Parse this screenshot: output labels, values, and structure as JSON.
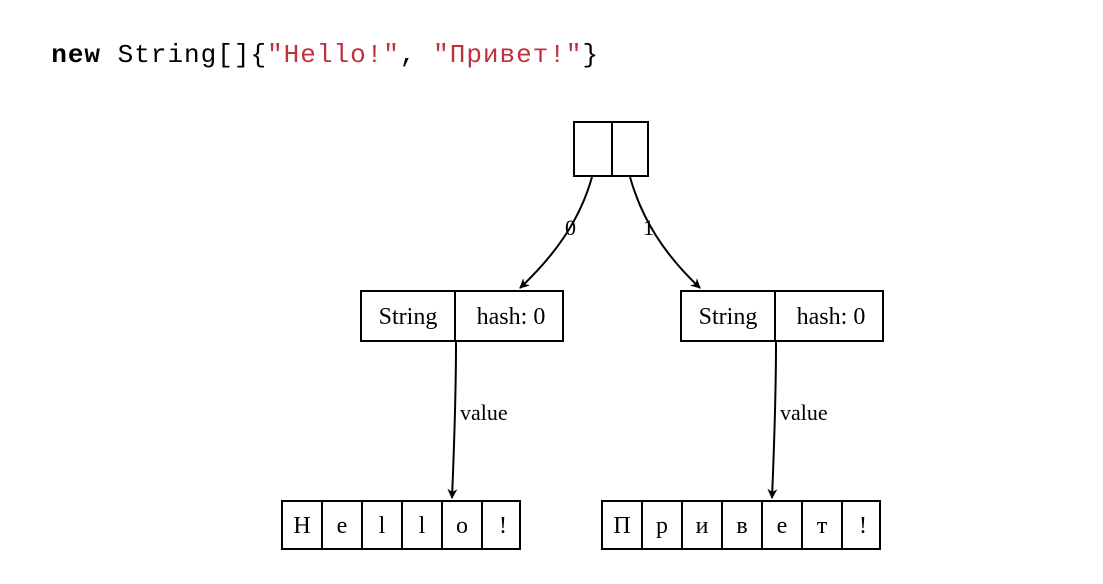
{
  "code": {
    "keyword": "new",
    "type": " String[]{",
    "str1": "\"Hello!\"",
    "comma": ", ",
    "str2": "\"Привет!\"",
    "close": "}"
  },
  "diagram": {
    "root_index_left": "0",
    "root_index_right": "1",
    "string_obj_left": {
      "type": "String",
      "hash": "hash: 0"
    },
    "string_obj_right": {
      "type": "String",
      "hash": "hash: 0"
    },
    "value_label_left": "value",
    "value_label_right": "value",
    "chars_left": [
      "H",
      "e",
      "l",
      "l",
      "o",
      "!"
    ],
    "chars_right": [
      "П",
      "р",
      "и",
      "в",
      "е",
      "т",
      "!"
    ]
  },
  "chart_data": {
    "type": "diagram",
    "title": "Java String array object graph",
    "root": {
      "kind": "array",
      "length": 2,
      "elements": [
        {
          "index": 0,
          "ref": "string0"
        },
        {
          "index": 1,
          "ref": "string1"
        }
      ]
    },
    "objects": {
      "string0": {
        "class": "String",
        "fields": {
          "hash": 0,
          "value": "charArray0"
        }
      },
      "string1": {
        "class": "String",
        "fields": {
          "hash": 0,
          "value": "charArray1"
        }
      },
      "charArray0": {
        "kind": "char[]",
        "chars": [
          "H",
          "e",
          "l",
          "l",
          "o",
          "!"
        ]
      },
      "charArray1": {
        "kind": "char[]",
        "chars": [
          "П",
          "р",
          "и",
          "в",
          "е",
          "т",
          "!"
        ]
      }
    }
  }
}
